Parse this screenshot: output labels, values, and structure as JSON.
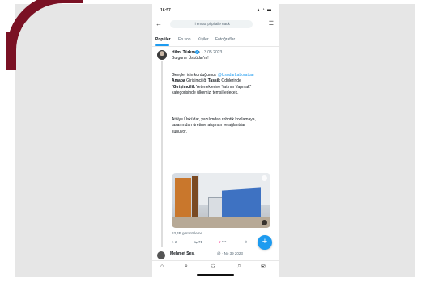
{
  "status_bar": {
    "time": "16:57",
    "icons": "▴ ◔ ▬"
  },
  "search": {
    "query": "Ti envaa phpilaile eauk"
  },
  "tabs": [
    {
      "label": "Popüler",
      "active": true
    },
    {
      "label": "En son",
      "active": false
    },
    {
      "label": "Kişiler",
      "active": false
    },
    {
      "label": "Fotoğraflar",
      "active": false
    }
  ],
  "tweet": {
    "author": "Hilmi Türkmen",
    "date": "· 3.05.2023",
    "subtitle": "Bu gurur Üsküdar'ın!",
    "p1": {
      "t1": "Gençler için kurduğumuz ",
      "mention": "@UsudarLaboratuar",
      "t2": " ",
      "bold1": "Amapa",
      "t3": " Girişimciliği ",
      "bold2": "Taşsik",
      "t4": " Ödülerinde \"",
      "bold3": "Girişimcilik",
      "t5": " Yeteneklerine Yatırım Yapmak\" kategorisinde ülkemizi temsil edecek."
    },
    "p2": "Atölye Üsküdar, yazılımdan robotik kodlamaya, tasarımdan üretime atışman ve ağlantılar sunuyor.",
    "views": "63,4B görüntüleme",
    "actions": {
      "replies": "2",
      "retweets": "71",
      "likes": "***"
    }
  },
  "next_tweet": {
    "author": "Mehmet Ses.",
    "handle": "@ · No 39 2023"
  },
  "colors": {
    "accent": "#7a1124",
    "twitter_blue": "#1d9bf0",
    "backdrop": "#e6e6e6"
  },
  "icons": {
    "back": "back-arrow-icon",
    "filter": "filter-icon",
    "compose": "compose-plus-icon",
    "nav": [
      "home-icon",
      "search-icon",
      "communities-icon",
      "notifications-icon",
      "messages-icon"
    ]
  }
}
